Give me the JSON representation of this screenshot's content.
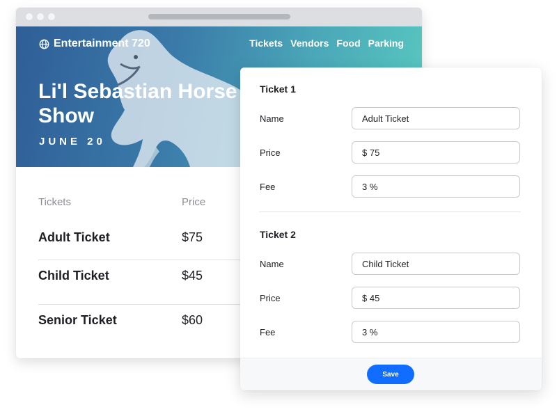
{
  "site": {
    "brand": "Entertainment 720",
    "nav": [
      "Tickets",
      "Vendors",
      "Food",
      "Parking"
    ],
    "event_title": "Li'l Sebastian Horse Show",
    "event_date": "JUNE 20"
  },
  "ticket_table": {
    "headers": {
      "name": "Tickets",
      "price": "Price"
    },
    "rows": [
      {
        "name": "Adult Ticket",
        "price": "$75"
      },
      {
        "name": "Child Ticket",
        "price": "$45"
      },
      {
        "name": "Senior Ticket",
        "price": "$60"
      }
    ]
  },
  "editor": {
    "tickets": [
      {
        "title": "Ticket 1",
        "name_label": "Name",
        "name_value": "Adult Ticket",
        "price_label": "Price",
        "price_value": "$ 75",
        "fee_label": "Fee",
        "fee_value": "3 %"
      },
      {
        "title": "Ticket 2",
        "name_label": "Name",
        "name_value": "Child Ticket",
        "price_label": "Price",
        "price_value": "$ 45",
        "fee_label": "Fee",
        "fee_value": "3 %"
      }
    ],
    "save_label": "Save"
  },
  "colors": {
    "accent": "#116dff",
    "hero_start": "#2f5e97",
    "hero_end": "#58c9c0"
  }
}
